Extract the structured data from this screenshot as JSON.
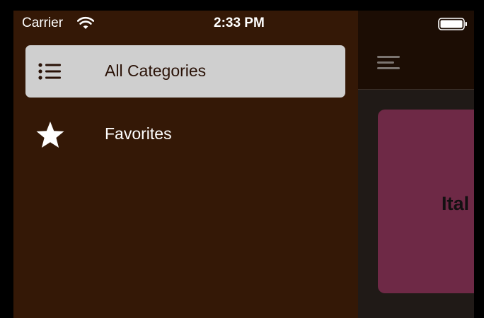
{
  "status_bar": {
    "carrier": "Carrier",
    "time": "2:33 PM"
  },
  "drawer": {
    "items": [
      {
        "label": "All Categories",
        "icon": "list-icon",
        "selected": true
      },
      {
        "label": "Favorites",
        "icon": "star-icon",
        "selected": false
      }
    ]
  },
  "main": {
    "card_title": "Ital"
  },
  "colors": {
    "drawer_bg": "#341806",
    "selected_bg": "#cfcfcf",
    "card_bg": "#6e2946"
  }
}
